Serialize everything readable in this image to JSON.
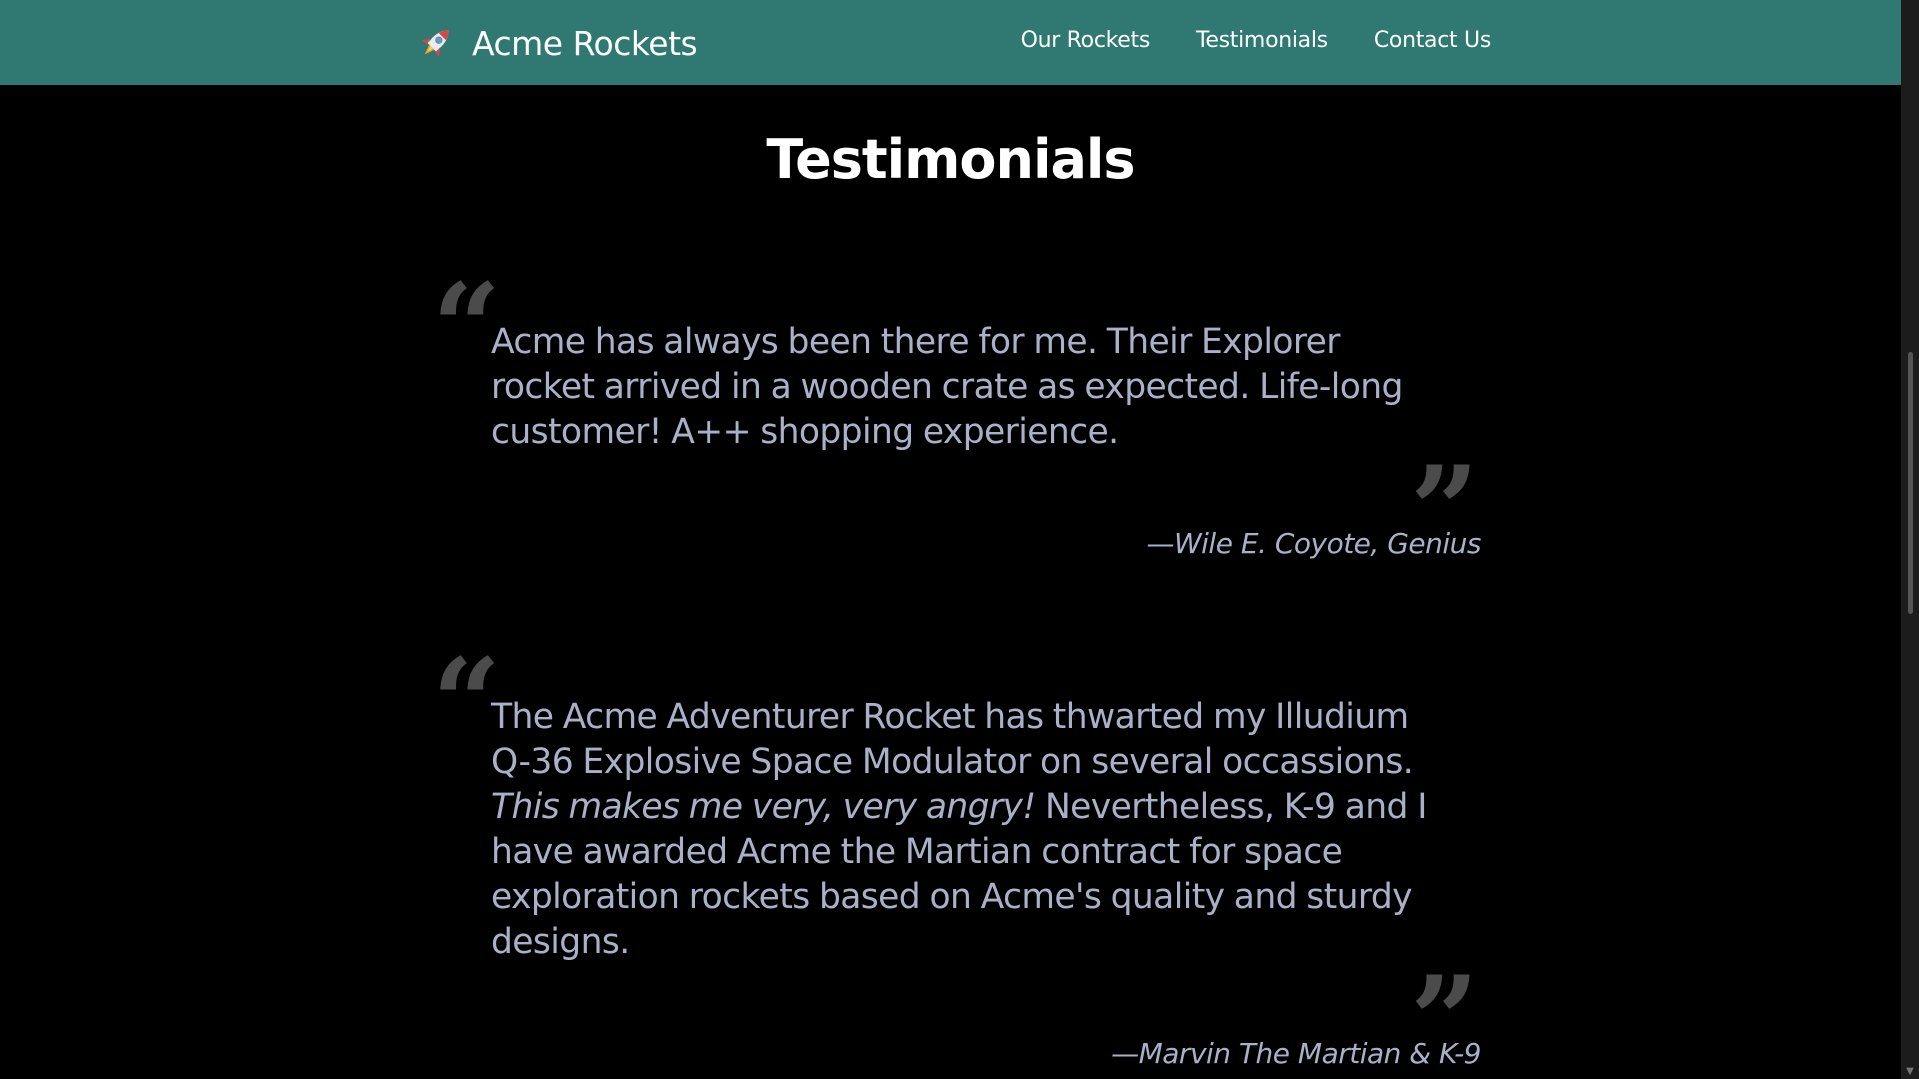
{
  "header": {
    "brand_name": "Acme Rockets",
    "brand_icon": "rocket-icon",
    "background_color": "#2f7972",
    "nav": [
      {
        "label": "Our Rockets"
      },
      {
        "label": "Testimonials"
      },
      {
        "label": "Contact Us"
      }
    ]
  },
  "main": {
    "title": "Testimonials",
    "testimonials": [
      {
        "open_quote": "“",
        "close_quote": "”",
        "text": "Acme has always been there for me. Their Explorer rocket arrived in a wooden crate as expected. Life-long customer! A++ shopping experience.",
        "attribution": "—Wile E. Coyote, Genius"
      },
      {
        "open_quote": "“",
        "close_quote": "”",
        "text_part1": "The Acme Adventurer Rocket has thwarted my Illudium Q-36 Explosive Space Modulator on several occassions. ",
        "text_emphasis": "This makes me very, very angry!",
        "text_part2": " Nevertheless, K-9 and I have awarded Acme the Martian contract for space exploration rockets based on Acme's quality and sturdy designs.",
        "attribution": "—Marvin The Martian & K-9"
      }
    ]
  },
  "colors": {
    "page_background": "#000000",
    "quote_text": "#a9b1c9",
    "quote_marks": "#4b4b4b"
  }
}
